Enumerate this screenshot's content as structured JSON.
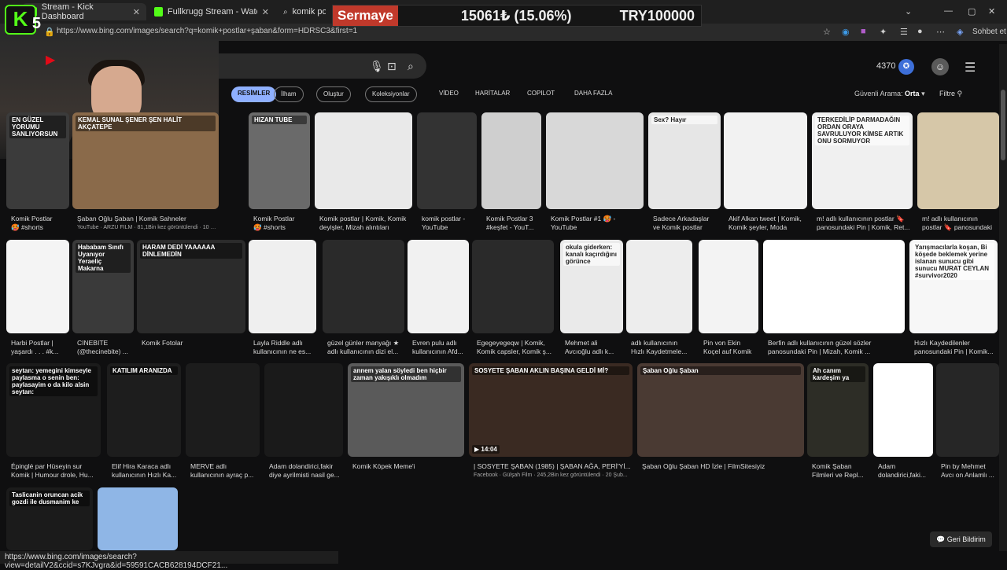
{
  "tabs": [
    {
      "title": "Stream - Kick Dashboard",
      "color": "#53fc18"
    },
    {
      "title": "Fullkrugg Stream - Watch Live on Kick",
      "color": "#53fc18"
    },
    {
      "title": "komik postlar ş",
      "color": "#3d6fd8"
    }
  ],
  "address": {
    "url": "https://www.bing.com/images/search?q=komik+postlar+şaban&form=HDRSC3&first=1"
  },
  "browser_right": {
    "profile_label": "Sohbet et"
  },
  "overlay": {
    "badge_k": "K",
    "badge_num": "5",
    "ticker_label": "Sermaye",
    "ticker_amount": "15061₺ (15.06%)",
    "ticker_target": "TRY100000"
  },
  "bing": {
    "reward_count": "4370",
    "nav": {
      "resimler": "RESİMLER",
      "ilham": "İlham",
      "olustur": "Oluştur",
      "koleksiyonlar": "Koleksiyonlar",
      "video": "VİDEO",
      "haritalar": "HARİTALAR",
      "copilot": "COPILOT",
      "daha_fazla": "DAHA FAZLA"
    },
    "safe_search_label": "Güvenli Arama:",
    "safe_search_value": "Orta",
    "filter_label": "Filtre",
    "feedback_label": "Geri Bildirim"
  },
  "status_url": "https://www.bing.com/images/search?view=detailV2&ccid=s7KJvgra&id=59591CACB628194DCF21...",
  "rows": [
    [
      {
        "t1": "Komik Postlar",
        "t2": "🥵 #shorts",
        "tag": "EN GÜZEL YORUMU SANLIYORSUN",
        "bg": "#3b3b3b"
      },
      {
        "t1": "Şaban Oğlu Şaban | Komik Sahneler",
        "t2": "YouTube · ARZU FILM · 81,1Bin kez görüntülendi · 10 Mar 2016",
        "tag": "KEMAL SUNAL   ŞENER ŞEN   HALİT AKÇATEPE",
        "bg": "#8a6a4a"
      },
      {
        "t1": "Komik Postlar",
        "t2": "🥵 #shorts",
        "tag": "HIZAN TUBE",
        "bg": "#6a6a6a"
      },
      {
        "t1": "Komik postlar | Komik, Komik",
        "t2": "deyişler, Mizah alıntıları",
        "tag": "",
        "bg": "#e9e9e9"
      },
      {
        "t1": "komik postlar -",
        "t2": "YouTube",
        "tag": "",
        "bg": "#333"
      },
      {
        "t1": "Komik Postlar 3",
        "t2": "#keşfet - YouT...",
        "tag": "",
        "bg": "#cfcfcf"
      },
      {
        "t1": "Komik Postlar #1 🥵 -",
        "t2": "YouTube",
        "tag": "",
        "bg": "#d8d8d8"
      },
      {
        "t1": "Sadece Arkadaşlar",
        "t2": "ve Komik postlar",
        "tag": "Sex?   Hayır",
        "bg": "#e6e6e6"
      },
      {
        "t1": "Akif Alkan tweet | Komik,",
        "t2": "Komik şeyler, Moda",
        "tag": "",
        "bg": "#f2f2f2"
      },
      {
        "t1": "m! adlı kullanıcının postlar 🔖",
        "t2": "panosundaki Pin | Komik, Ret...",
        "tag": "TERKEDİLİP DARMADAĞIN ORDAN ORAYA SAVRULUYOR KİMSE ARTIK ONU SORMUYOR",
        "bg": "#f0f0f0"
      },
      {
        "t1": "m! adlı kullanıcının",
        "t2": "postlar 🔖 panosundaki",
        "tag": "",
        "bg": "#d6c7a8"
      }
    ],
    [
      {
        "t1": "Harbi Postlar |",
        "t2": "yaşardı . . . #k...",
        "tag": "",
        "bg": "#f4f4f4"
      },
      {
        "t1": "CINEBITE",
        "t2": "(@thecinebite) ...",
        "tag": "Hababam Sınıfı Uyanıyor Yeraeliç Makarna",
        "bg": "#3a3a3a"
      },
      {
        "t1": "Komik Fotolar",
        "t2": "",
        "tag": "HARAM DEDİ   YAAAAAA   DİNLEMEDİN",
        "bg": "#2b2b2b"
      },
      {
        "t1": "Layla Riddle adlı",
        "t2": "kullanıcının ne es...",
        "tag": "",
        "bg": "#efefef"
      },
      {
        "t1": "güzel günler manyağı ★",
        "t2": "adlı kullanıcının dizi el...",
        "tag": "",
        "bg": "#2a2a2a"
      },
      {
        "t1": "Evren pulu adlı",
        "t2": "kullanıcının Afd...",
        "tag": "",
        "bg": "#f1f1f1"
      },
      {
        "t1": "Egegeyegeqw | Komik,",
        "t2": "Komik capsler, Komik ş...",
        "tag": "",
        "bg": "#2a2a2a"
      },
      {
        "t1": "Mehmet ali",
        "t2": "Avcıoğlu adlı k...",
        "tag": "okula giderken: kanalı kaçırdığını görünce",
        "bg": "#eaeaea"
      },
      {
        "t1": "adlı kullanıcının",
        "t2": "Hızlı Kaydetmele...",
        "tag": "",
        "bg": "#ededed"
      },
      {
        "t1": "Pin von Ekin",
        "t2": "Koçel auf Komik",
        "tag": "",
        "bg": "#f3f3f3"
      },
      {
        "t1": "Berfin adlı kullanıcının güzel sözler",
        "t2": "panosundaki Pin | Mizah, Komik ...",
        "tag": "",
        "bg": "#ffffff"
      },
      {
        "t1": "Hızlı Kaydedilenler",
        "t2": "panosundaki Pin | Komik...",
        "tag": "Yarışmacılarla koşan, Bi köşede beklemek yerine islanan sunucu gibi sunucu MURAT CEYLAN #survivor2020",
        "bg": "#f7f7f7"
      }
    ],
    [
      {
        "t1": "Épinglé par Hüseyin sur",
        "t2": "Komik | Humour drole, Hu...",
        "tag": "seytan: yemegini kimseyle paylasma o senin   ben: paylasayim o da kilo alsin   seytan:",
        "bg": "#1b1b1b"
      },
      {
        "t1": "Elif Hira Karaca adlı",
        "t2": "kullanıcının Hızlı Ka...",
        "tag": "KATILIM ARANIZDA",
        "bg": "#1d1d1d"
      },
      {
        "t1": "MERVE adlı",
        "t2": "kullanıcının ayraç p...",
        "tag": "",
        "bg": "#1c1c1c"
      },
      {
        "t1": "Adam dolandirici,fakir",
        "t2": "diye ayrilmisti nasil ge...",
        "tag": "",
        "bg": "#1a1a1a"
      },
      {
        "t1": "Komik Köpek Meme'i",
        "t2": "",
        "tag": "annem yalan söyledi ben hiçbir zaman yakışıklı olmadım",
        "bg": "#5a5a5a"
      },
      {
        "t1": "| SOSYETE ŞABAN (1985) | ŞABAN AĞA, PERİ'Yİ...",
        "t2": "Facebook · Gülşah Film · 245,2Bin kez görüntülendi · 20 Şub...",
        "tag": "SOSYETE ŞABAN   AKLIN BAŞINA GELDİ Mİ?",
        "bg": "#3a2a22",
        "dur": "14:04"
      },
      {
        "t1": "Şaban Oğlu Şaban HD İzle | FilmSitesiyiz",
        "t2": "",
        "tag": "Şaban Oğlu Şaban",
        "bg": "#4a3a33"
      },
      {
        "t1": "Komik Şaban",
        "t2": "Filmleri ve Repl...",
        "tag": "Ah canım kardeşim ya",
        "bg": "#2d2d26"
      },
      {
        "t1": "Adam",
        "t2": "dolandirici,faki...",
        "tag": "",
        "bg": "#ffffff"
      },
      {
        "t1": "Pin by Mehmet",
        "t2": "Avcı on Anlamlı ...",
        "tag": "",
        "bg": "#262626"
      }
    ],
    [
      {
        "t1": "",
        "t2": "",
        "tag": "Taslicanin oruncan acik gozdi ile dusmanim ke",
        "bg": "#1b1b1b"
      },
      {
        "t1": "",
        "t2": "",
        "tag": "",
        "bg": "#8fb6e6"
      }
    ]
  ]
}
